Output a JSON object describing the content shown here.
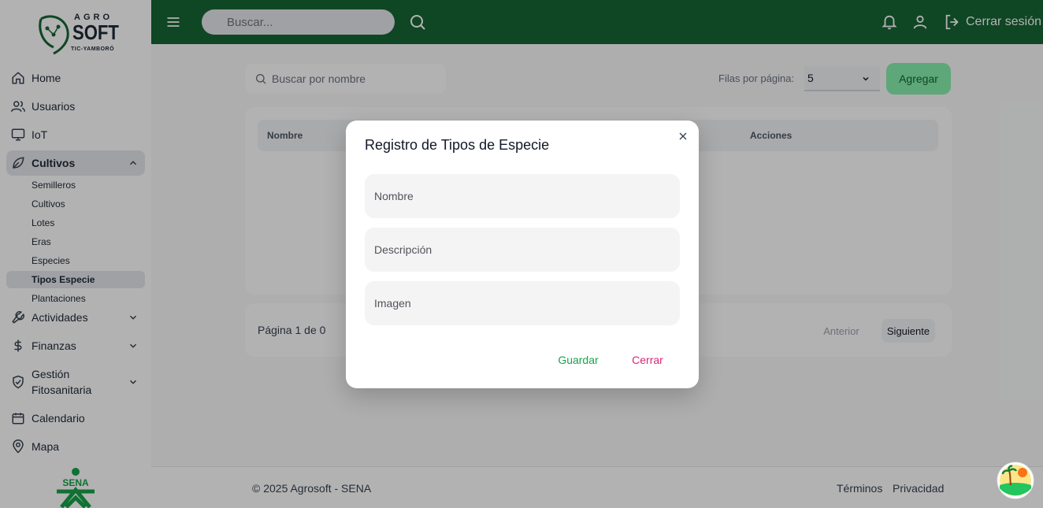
{
  "brand": {
    "logo_top": "AGRO",
    "logo_main": "SOFT",
    "logo_sub": "TIC-YAMBORÓ",
    "sena": "SENA"
  },
  "sidebar": {
    "items": [
      {
        "label": "Home",
        "icon": "home-icon"
      },
      {
        "label": "Usuarios",
        "icon": "users-icon"
      },
      {
        "label": "IoT",
        "icon": "monitor-icon"
      },
      {
        "label": "Cultivos",
        "icon": "leaf-icon",
        "expanded": true
      },
      {
        "label": "Actividades",
        "icon": "wrench-icon"
      },
      {
        "label": "Finanzas",
        "icon": "dollar-icon"
      },
      {
        "label": "Gestión Fitosanitaria",
        "icon": "shield-icon"
      },
      {
        "label": "Calendario",
        "icon": "calendar-icon"
      },
      {
        "label": "Mapa",
        "icon": "map-pin-icon"
      }
    ],
    "cultivos_sub": [
      "Semilleros",
      "Cultivos",
      "Lotes",
      "Eras",
      "Especies",
      "Tipos Especie",
      "Plantaciones"
    ],
    "active_sub": "Tipos Especie"
  },
  "topbar": {
    "search_placeholder": "Buscar...",
    "logout_label": "Cerrar sesión"
  },
  "toolbar": {
    "search_placeholder": "Buscar por nombre",
    "rows_label": "Filas por página:",
    "rows_value": "5",
    "add_label": "Agregar"
  },
  "table": {
    "columns": [
      "Nombre",
      "Acciones"
    ]
  },
  "pager": {
    "text": "Página 1 de 0",
    "prev": "Anterior",
    "next": "Siguiente"
  },
  "footer": {
    "copyright": "© 2025 Agrosoft - SENA",
    "terms": "Términos",
    "privacy": "Privacidad"
  },
  "modal": {
    "title": "Registro de Tipos de Especie",
    "fields": [
      "Nombre",
      "Descripción",
      "Imagen"
    ],
    "save": "Guardar",
    "close": "Cerrar"
  },
  "colors": {
    "topbar": "#166534",
    "accent": "#16a34a",
    "danger": "#db2777"
  }
}
